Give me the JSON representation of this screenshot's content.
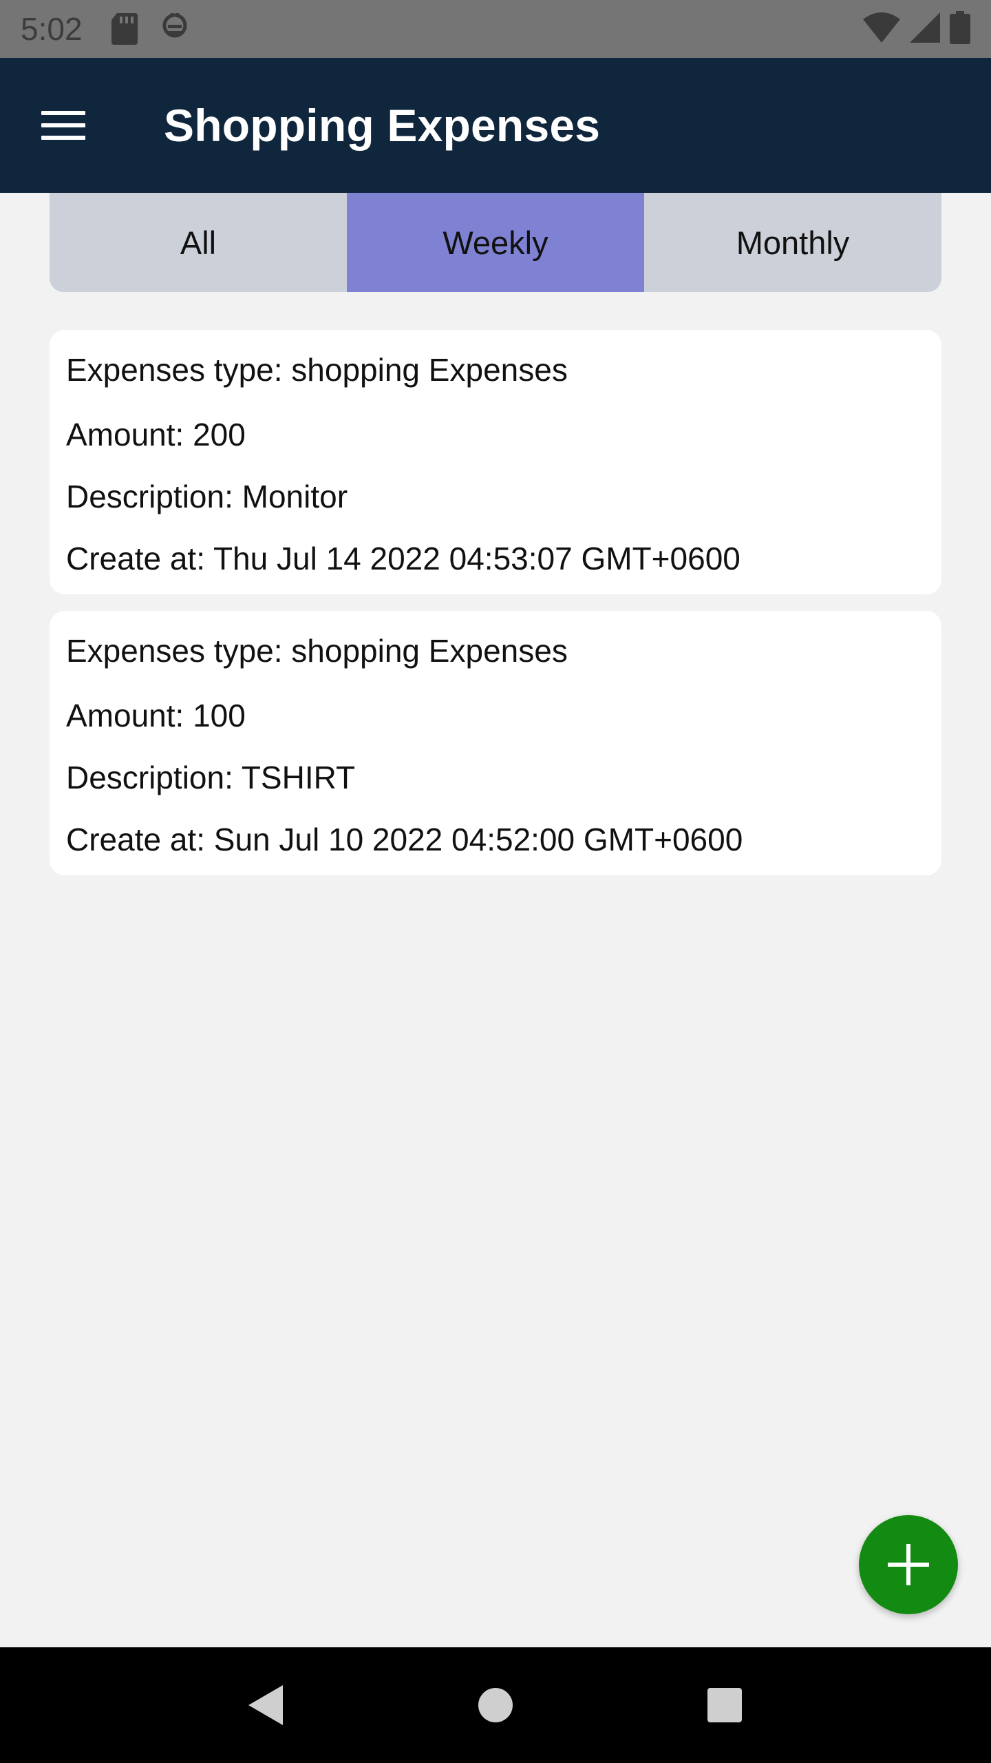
{
  "status_bar": {
    "time": "5:02",
    "icons": [
      "sd-card-icon",
      "debug-icon",
      "wifi-icon",
      "signal-icon",
      "battery-icon"
    ]
  },
  "app_bar": {
    "title": "Shopping Expenses",
    "menu_icon": "hamburger-menu-icon"
  },
  "tabs": [
    {
      "label": "All",
      "active": false
    },
    {
      "label": "Weekly",
      "active": true
    },
    {
      "label": "Monthly",
      "active": false
    }
  ],
  "expenses": [
    {
      "type": "Expenses type: shopping Expenses",
      "amount": "Amount: 200",
      "description": "Description: Monitor",
      "created": "Create at: Thu Jul 14 2022 04:53:07 GMT+0600"
    },
    {
      "type": "Expenses type: shopping Expenses",
      "amount": "Amount: 100",
      "description": "Description: TSHIRT",
      "created": "Create at: Sun Jul 10 2022 04:52:00 GMT+0600"
    }
  ],
  "fab": {
    "icon": "plus-icon"
  },
  "nav_bar": {
    "icons": [
      "back-icon",
      "home-icon",
      "recents-icon"
    ]
  },
  "colors": {
    "app_bar": "#10263d",
    "active_tab": "#7f82d2",
    "inactive_tab": "#ccd1d9",
    "fab": "#138a12",
    "background": "#f2f2f2"
  }
}
